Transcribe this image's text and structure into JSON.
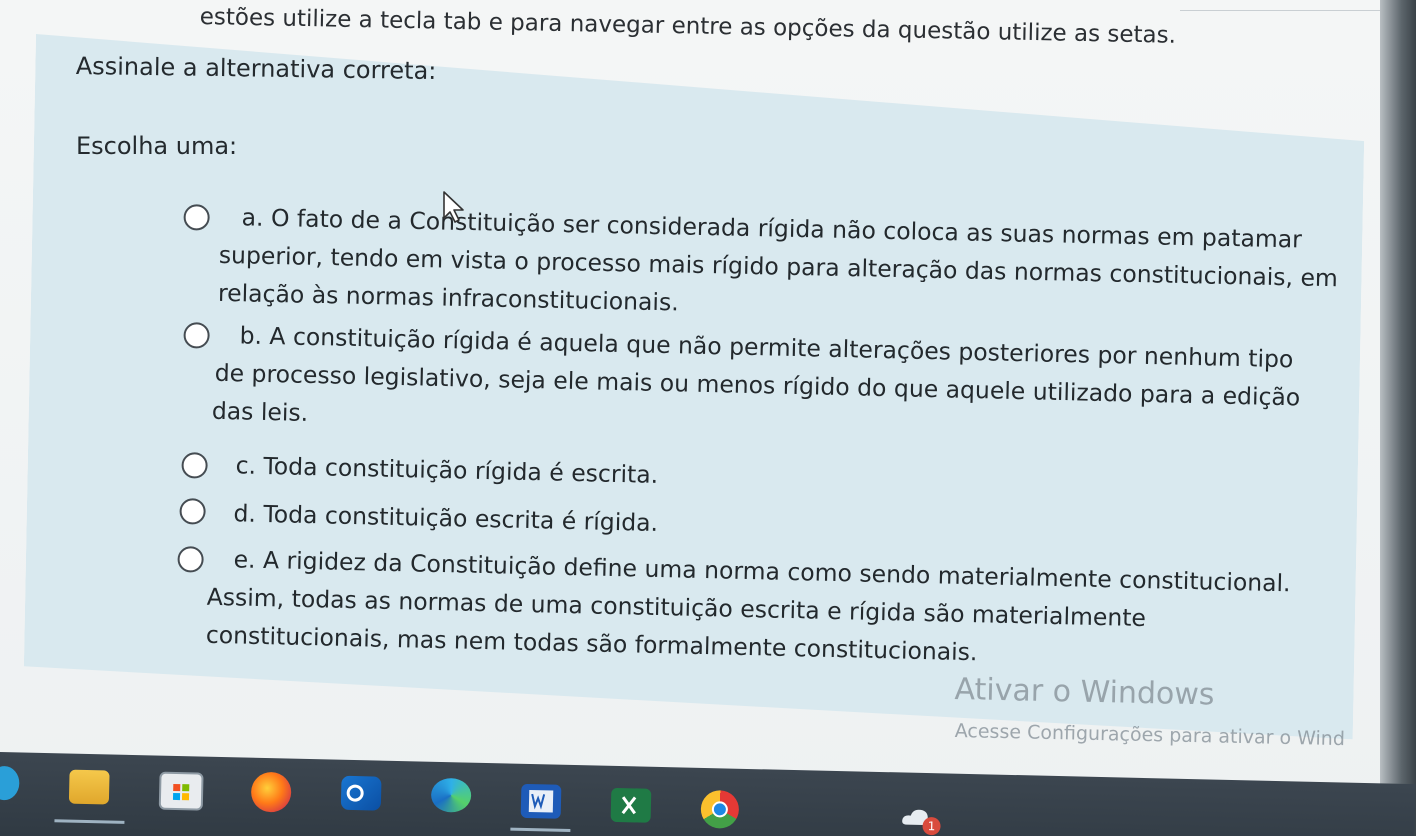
{
  "instruction_text": "estões utilize a tecla tab e para navegar entre as opções da questão utilize as setas.",
  "question": {
    "prompt": "Assinale a alternativa correta:",
    "choose_label": "Escolha uma:",
    "options": [
      {
        "lines": [
          "a. O fato de a Constituição ser considerada rígida não coloca as suas normas em patamar",
          "superior, tendo em vista o processo mais rígido para alteração das normas constitucionais, em",
          "relação às normas infraconstitucionais."
        ]
      },
      {
        "lines": [
          "b. A constituição rígida é aquela que não permite alterações posteriores por nenhum tipo",
          "de processo legislativo, seja ele mais ou menos rígido do que aquele utilizado para a edição",
          "das leis."
        ]
      },
      {
        "lines": [
          "c. Toda constituição rígida é escrita."
        ]
      },
      {
        "lines": [
          "d. Toda constituição escrita é rígida."
        ]
      },
      {
        "lines": [
          "e. A rigidez da Constituição define uma norma como sendo materialmente constitucional.",
          "Assim, todas as normas de uma constituição escrita e rígida são materialmente",
          "constitucionais, mas nem todas são formalmente constitucionais."
        ]
      }
    ]
  },
  "watermark": {
    "title": "Ativar o Windows",
    "subtitle": "Acesse Configurações para ativar o Wind"
  },
  "taskbar": {
    "icons": [
      "file-explorer-icon",
      "microsoft-store-icon",
      "firefox-icon",
      "outlook-icon",
      "edge-icon",
      "word-icon",
      "excel-icon",
      "chrome-icon",
      "onedrive-icon"
    ],
    "notification_count": "1"
  }
}
